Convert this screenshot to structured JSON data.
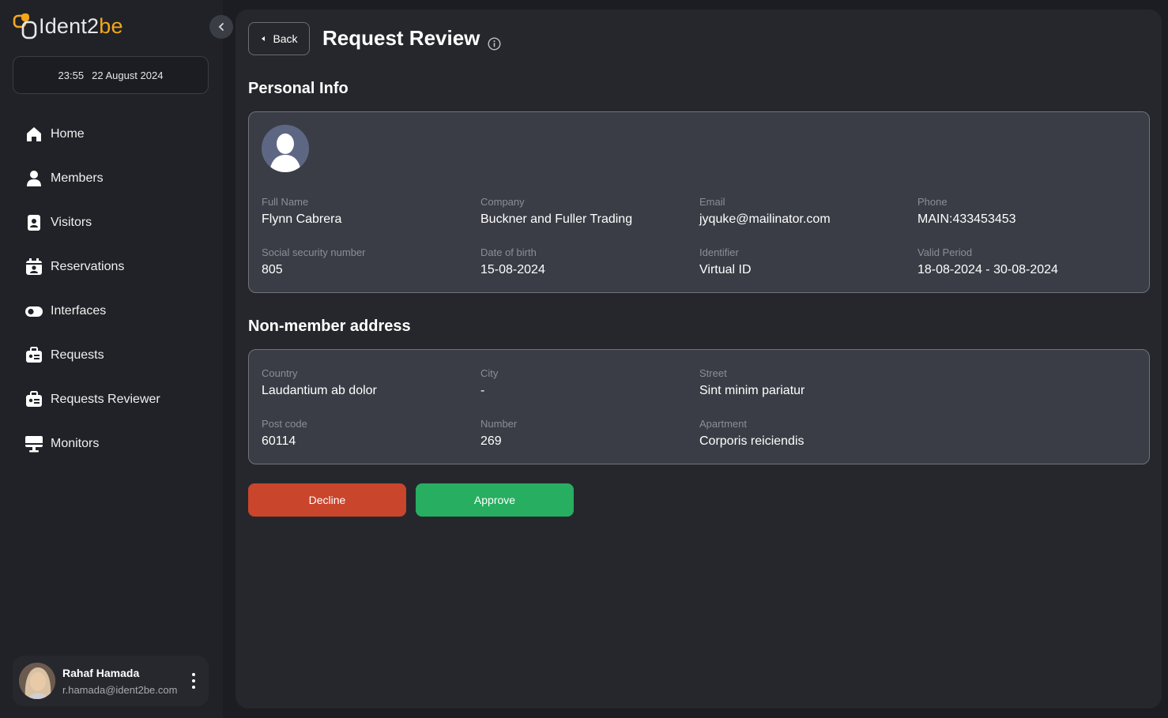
{
  "brand": {
    "logo_part1": "Ident2",
    "logo_part2": "be",
    "accent": "#f2a71b"
  },
  "datetime": {
    "time": "23:55",
    "date": "22 August 2024"
  },
  "nav": {
    "items": [
      {
        "label": "Home",
        "icon": "home-icon"
      },
      {
        "label": "Members",
        "icon": "person-icon"
      },
      {
        "label": "Visitors",
        "icon": "badge-icon"
      },
      {
        "label": "Reservations",
        "icon": "calendar-person-icon"
      },
      {
        "label": "Interfaces",
        "icon": "toggle-icon"
      },
      {
        "label": "Requests",
        "icon": "id-card-icon"
      },
      {
        "label": "Requests Reviewer",
        "icon": "id-card-icon"
      },
      {
        "label": "Monitors",
        "icon": "monitor-icon"
      }
    ]
  },
  "user": {
    "name": "Rahaf Hamada",
    "email": "r.hamada@ident2be.com"
  },
  "header": {
    "back_label": "Back",
    "title": "Request Review"
  },
  "personal_info": {
    "section_title": "Personal Info",
    "fields": [
      {
        "label": "Full Name",
        "value": "Flynn Cabrera"
      },
      {
        "label": "Company",
        "value": "Buckner and Fuller Trading"
      },
      {
        "label": "Email",
        "value": "jyquke@mailinator.com"
      },
      {
        "label": "Phone",
        "value": "MAIN:433453453"
      },
      {
        "label": "Social security number",
        "value": "805"
      },
      {
        "label": "Date of birth",
        "value": "15-08-2024"
      },
      {
        "label": "Identifier",
        "value": "Virtual ID"
      },
      {
        "label": "Valid Period",
        "value": "18-08-2024 - 30-08-2024"
      }
    ]
  },
  "address": {
    "section_title": "Non-member address",
    "fields": [
      {
        "label": "Country",
        "value": "Laudantium ab dolor"
      },
      {
        "label": "City",
        "value": "-"
      },
      {
        "label": "Street",
        "value": "Sint minim pariatur"
      },
      {
        "label": "Post code",
        "value": "60114"
      },
      {
        "label": "Number",
        "value": "269"
      },
      {
        "label": "Apartment",
        "value": "Corporis reiciendis"
      }
    ]
  },
  "actions": {
    "decline_label": "Decline",
    "approve_label": "Approve",
    "decline_color": "#c9452c",
    "approve_color": "#27ae60"
  }
}
